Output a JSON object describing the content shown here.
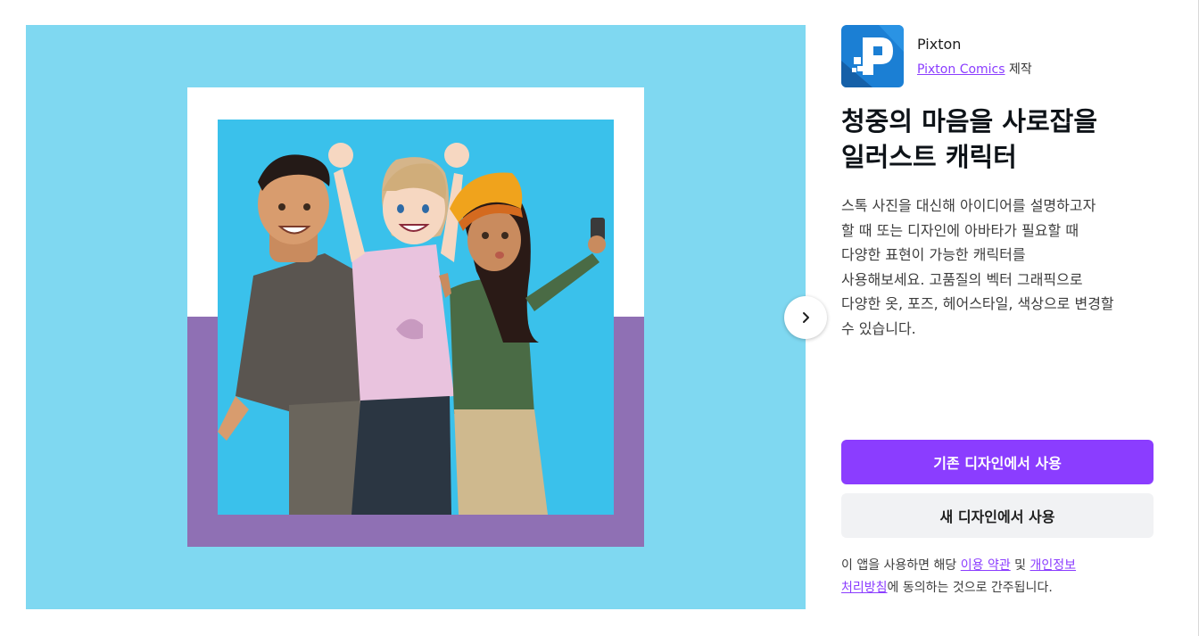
{
  "app": {
    "name": "Pixton",
    "maker_link": "Pixton Comics",
    "maker_suffix": "제작",
    "icon": "pixton-logo-icon",
    "icon_colors": {
      "background": "#1976c9",
      "mark": "#ffffff"
    }
  },
  "title_lines": [
    "청중의 마음을 사로잡을",
    "일러스트 캐릭터"
  ],
  "description_lines": [
    "스톡 사진을 대신해 아이디어를 설명하고자",
    "할 때 또는 디자인에 아바타가 필요할 때",
    "다양한 표현이 가능한 캐릭터를",
    "사용해보세요. 고품질의 벡터 그래픽으로",
    "다양한 옷, 포즈, 헤어스타일, 색상으로 변경할",
    "수 있습니다."
  ],
  "buttons": {
    "use_existing": "기존 디자인에서 사용",
    "use_new": "새 디자인에서 사용"
  },
  "terms": {
    "prefix": "이 앱을 사용하면 해당",
    "terms_link": "이용 약관",
    "and": "및",
    "privacy_link_line1": "개인정보",
    "privacy_link_line2": "처리방침",
    "suffix": "에 동의하는 것으로 간주됩니다."
  },
  "carousel": {
    "next_icon": "chevron-right-icon"
  },
  "colors": {
    "accent": "#8b3dff",
    "preview_bg": "#7fd8f1",
    "frame_purple": "#8f70b4",
    "photo_bg": "#3ac1eb",
    "secondary_button_bg": "#f1f2f4"
  }
}
